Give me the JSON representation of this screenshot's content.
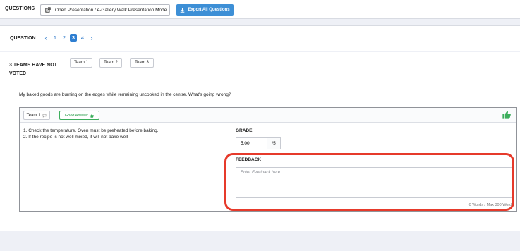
{
  "header": {
    "title": "QUESTIONS",
    "open_button": "Open Presentation / e-Gallery Walk Presentation Mode",
    "export_button": "Export All Questions"
  },
  "question_nav": {
    "label": "QUESTION",
    "prev_icon": "chevron-left-icon",
    "next_icon": "chevron-right-icon",
    "pages": [
      "1",
      "2",
      "3",
      "4"
    ],
    "active_page": "3"
  },
  "not_voted": {
    "label": "3 TEAMS HAVE NOT VOTED",
    "teams": [
      "Team 1",
      "Team 2",
      "Team 3"
    ]
  },
  "question_text": "My baked goods are burning on the edges while remaining uncooked in the centre. What's going wrong?",
  "answer_card": {
    "team": "Team 1",
    "good_answer_label": "Good Answer",
    "answer_lines": [
      "1. Check the temperature. Oven must be preheated before baking.",
      "2. If the recipe is not well mixed, it will not bake well"
    ],
    "grade_label": "GRADE",
    "grade_value": "5.00",
    "grade_max": "/5",
    "feedback_label": "FEEDBACK",
    "feedback_placeholder": "Enter Feedback here...",
    "word_count": "0 Words / Max 300 Words"
  },
  "colors": {
    "accent_blue": "#3d8fd6",
    "good_green": "#3cae5c",
    "highlight_red": "#e63a2b"
  }
}
